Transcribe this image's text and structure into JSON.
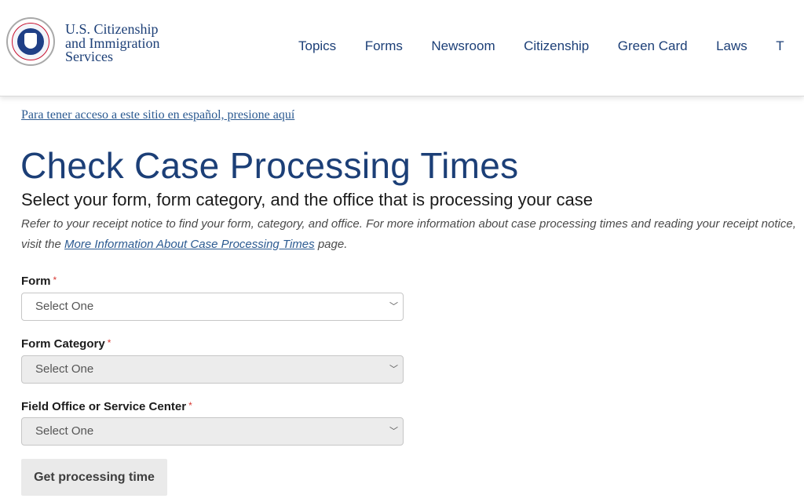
{
  "header": {
    "logo_lines": [
      "U.S. Citizenship",
      "and Immigration",
      "Services"
    ],
    "seal_icon": "dhs-seal-icon",
    "nav": [
      "Topics",
      "Forms",
      "Newsroom",
      "Citizenship",
      "Green Card",
      "Laws",
      "T"
    ]
  },
  "spanish_link": "Para tener acceso a este sitio en español, presione aquí",
  "page_title": "Check Case Processing Times",
  "subtitle": "Select your form, form category, and the office that is processing your case",
  "help": {
    "text_before": "Refer to your receipt notice to find your form, category, and office. For more information about case processing times and reading your receipt notice, visit the ",
    "link": "More Information About Case Processing Times",
    "text_after": " page."
  },
  "fields": [
    {
      "label": "Form",
      "required_mark": "*",
      "value": "Select One",
      "state": "enabled"
    },
    {
      "label": "Form Category",
      "required_mark": "*",
      "value": "Select One",
      "state": "disabled"
    },
    {
      "label": "Field Office or Service Center",
      "required_mark": "*",
      "value": "Select One",
      "state": "disabled"
    }
  ],
  "chevron_glyph": "﹀",
  "submit_label": "Get processing time",
  "colors": {
    "brand_navy": "#1c3f77",
    "link_blue": "#2b5a91",
    "required_red": "#d83933"
  }
}
